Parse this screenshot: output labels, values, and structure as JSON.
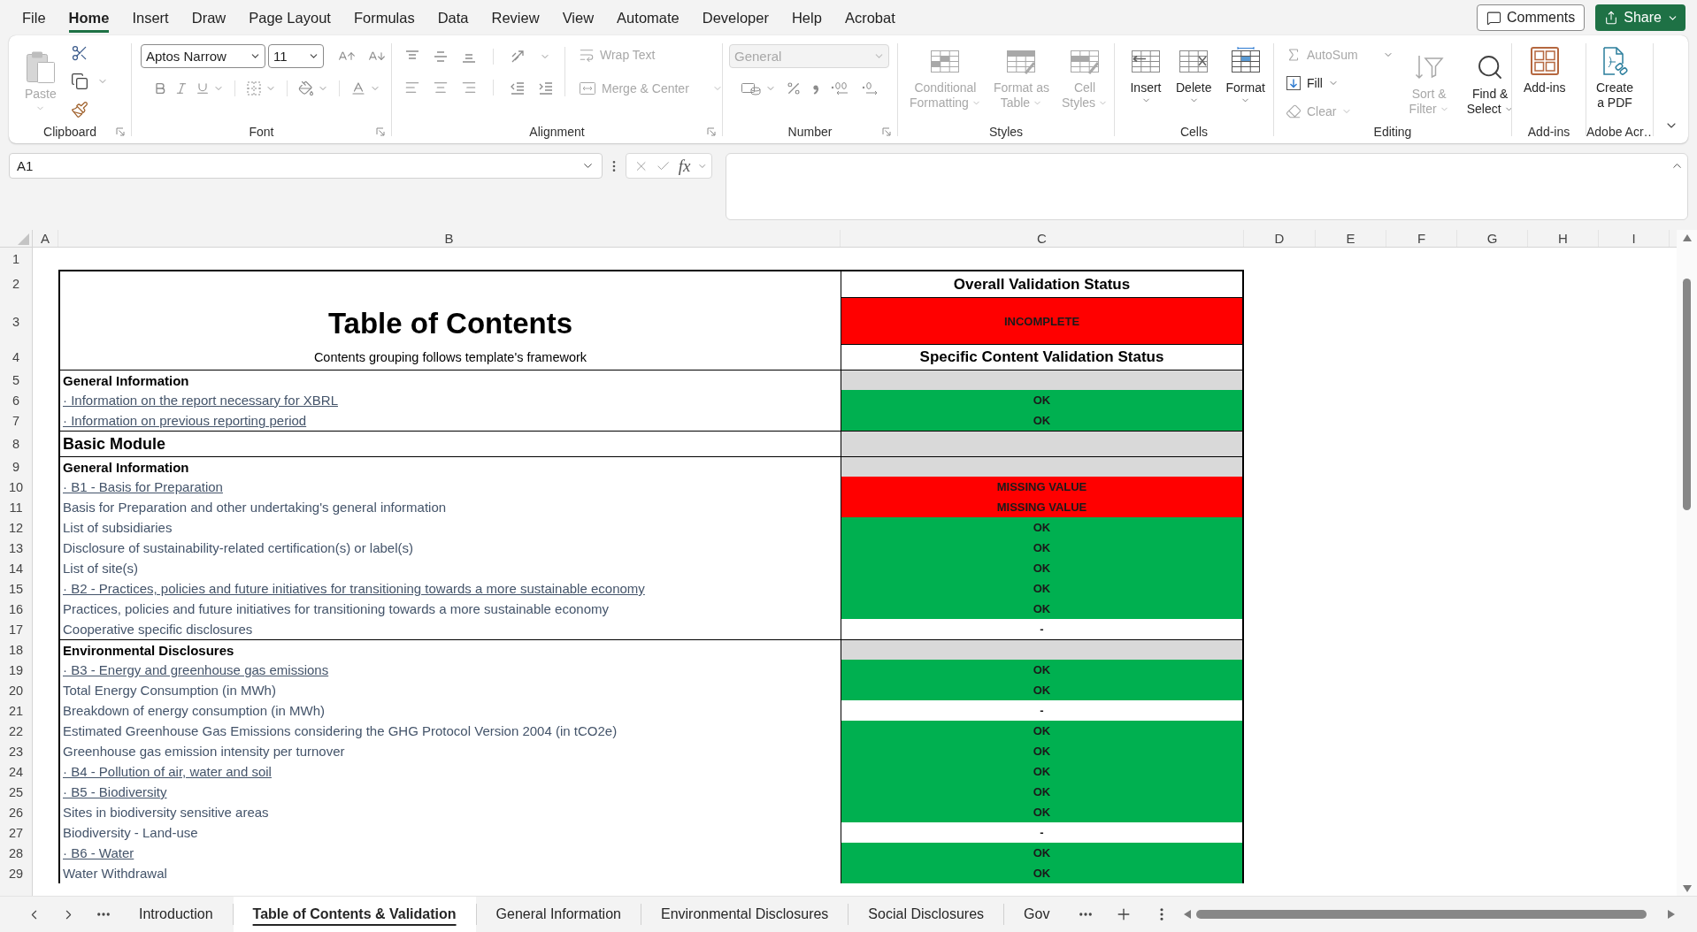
{
  "menu": {
    "tabs": [
      {
        "label": "File",
        "selected": false
      },
      {
        "label": "Home",
        "selected": true
      },
      {
        "label": "Insert",
        "selected": false
      },
      {
        "label": "Draw",
        "selected": false
      },
      {
        "label": "Page Layout",
        "selected": false
      },
      {
        "label": "Formulas",
        "selected": false
      },
      {
        "label": "Data",
        "selected": false
      },
      {
        "label": "Review",
        "selected": false
      },
      {
        "label": "View",
        "selected": false
      },
      {
        "label": "Automate",
        "selected": false
      },
      {
        "label": "Developer",
        "selected": false
      },
      {
        "label": "Help",
        "selected": false
      },
      {
        "label": "Acrobat",
        "selected": false
      }
    ],
    "comments": "Comments",
    "share": "Share"
  },
  "ribbon": {
    "groups": [
      {
        "kind": "clipboard",
        "label": "Clipboard",
        "paste": {
          "label": "Paste",
          "disabled": true
        }
      },
      {
        "kind": "font",
        "label": "Font",
        "font_name": "Aptos Narrow",
        "font_size": "11"
      },
      {
        "kind": "alignment",
        "label": "Alignment",
        "wrap": {
          "label": "Wrap Text",
          "disabled": true
        },
        "merge": {
          "label": "Merge & Center",
          "disabled": true
        }
      },
      {
        "kind": "number",
        "label": "Number",
        "format": {
          "value": "General",
          "disabled": true
        }
      },
      {
        "kind": "styles",
        "label": "Styles",
        "buttons": [
          {
            "lines": [
              "Conditional",
              "Formatting"
            ],
            "disabled": true
          },
          {
            "lines": [
              "Format as",
              "Table"
            ],
            "disabled": true
          },
          {
            "lines": [
              "Cell",
              "Styles"
            ],
            "disabled": true
          }
        ]
      },
      {
        "kind": "cells",
        "label": "Cells",
        "buttons": [
          {
            "lines": [
              "Insert"
            ],
            "disabled": false
          },
          {
            "lines": [
              "Delete"
            ],
            "disabled": false
          },
          {
            "lines": [
              "Format"
            ],
            "disabled": false
          }
        ]
      },
      {
        "kind": "editing",
        "label": "Editing",
        "small": [
          {
            "label": "AutoSum",
            "disabled": true
          },
          {
            "label": "Fill",
            "disabled": false
          },
          {
            "label": "Clear",
            "disabled": true
          }
        ],
        "buttons": [
          {
            "lines": [
              "Sort &",
              "Filter"
            ],
            "disabled": true
          },
          {
            "lines": [
              "Find &",
              "Select"
            ],
            "disabled": false
          }
        ]
      },
      {
        "kind": "addins",
        "label": "Add-ins",
        "buttons": [
          {
            "lines": [
              "Add-ins"
            ],
            "disabled": false
          }
        ]
      },
      {
        "kind": "adobe",
        "label": "Adobe Acr…",
        "buttons": [
          {
            "lines": [
              "Create",
              "a PDF"
            ],
            "disabled": false
          }
        ]
      }
    ]
  },
  "formula_bar": {
    "name_box": "A1",
    "function_symbol": "fx"
  },
  "sheet": {
    "columns": [
      "A",
      "B",
      "C",
      "D",
      "E",
      "F",
      "G",
      "H",
      "I"
    ],
    "top_rows": [
      "1",
      "2",
      "3",
      "4"
    ],
    "title": "Table of Contents",
    "subtitle": "Contents grouping follows template's framework",
    "overall_heading": "Overall Validation Status",
    "overall_status": {
      "kind": "fail",
      "text": "INCOMPLETE"
    },
    "specific_heading": "Specific Content Validation Status",
    "rows": [
      {
        "row": "5",
        "kind": "section",
        "text": "General Information",
        "status": {
          "kind": "heading"
        }
      },
      {
        "row": "6",
        "kind": "link",
        "text": "· Information on the report necessary for XBRL",
        "status": {
          "kind": "pass",
          "text": "OK"
        }
      },
      {
        "row": "7",
        "kind": "link",
        "text": "· Information on previous reporting period",
        "status": {
          "kind": "pass",
          "text": "OK"
        }
      },
      {
        "row": "8",
        "kind": "module",
        "text": "Basic Module",
        "status": {
          "kind": "heading"
        }
      },
      {
        "row": "9",
        "kind": "section",
        "text": "General Information",
        "status": {
          "kind": "heading"
        }
      },
      {
        "row": "10",
        "kind": "link",
        "text": "· B1 - Basis for Preparation",
        "status": {
          "kind": "fail",
          "text": "MISSING VALUE"
        }
      },
      {
        "row": "11",
        "kind": "item",
        "text": "Basis for Preparation and other undertaking's general information",
        "status": {
          "kind": "fail",
          "text": "MISSING VALUE"
        }
      },
      {
        "row": "12",
        "kind": "item",
        "text": "List of subsidiaries",
        "status": {
          "kind": "pass",
          "text": "OK"
        }
      },
      {
        "row": "13",
        "kind": "item",
        "text": "Disclosure of sustainability-related certification(s) or label(s)",
        "status": {
          "kind": "pass",
          "text": "OK"
        }
      },
      {
        "row": "14",
        "kind": "item",
        "text": "List of site(s)",
        "status": {
          "kind": "pass",
          "text": "OK"
        }
      },
      {
        "row": "15",
        "kind": "link",
        "text": "· B2 - Practices, policies and future initiatives for transitioning towards a more sustainable economy",
        "status": {
          "kind": "pass",
          "text": "OK"
        }
      },
      {
        "row": "16",
        "kind": "item",
        "text": "Practices, policies and future initiatives for transitioning towards a more sustainable economy",
        "status": {
          "kind": "pass",
          "text": "OK"
        }
      },
      {
        "row": "17",
        "kind": "item",
        "text": "Cooperative specific disclosures",
        "status": {
          "kind": "not_applicable",
          "text": "-"
        }
      },
      {
        "row": "18",
        "kind": "section",
        "text": "Environmental Disclosures",
        "status": {
          "kind": "heading"
        }
      },
      {
        "row": "19",
        "kind": "link",
        "text": "· B3 - Energy and greenhouse gas emissions",
        "status": {
          "kind": "pass",
          "text": "OK"
        }
      },
      {
        "row": "20",
        "kind": "item",
        "text": "Total Energy Consumption (in MWh)",
        "status": {
          "kind": "pass",
          "text": "OK"
        }
      },
      {
        "row": "21",
        "kind": "item",
        "text": "Breakdown of energy consumption (in MWh)",
        "status": {
          "kind": "not_applicable",
          "text": "-"
        }
      },
      {
        "row": "22",
        "kind": "item",
        "text": "Estimated Greenhouse Gas Emissions considering the GHG Protocol Version 2004 (in tCO2e)",
        "status": {
          "kind": "pass",
          "text": "OK"
        }
      },
      {
        "row": "23",
        "kind": "item",
        "text": "Greenhouse gas emission intensity per turnover",
        "status": {
          "kind": "pass",
          "text": "OK"
        }
      },
      {
        "row": "24",
        "kind": "link",
        "text": "· B4 - Pollution of air, water and soil",
        "status": {
          "kind": "pass",
          "text": "OK"
        }
      },
      {
        "row": "25",
        "kind": "link",
        "text": "· B5 - Biodiversity",
        "status": {
          "kind": "pass",
          "text": "OK"
        }
      },
      {
        "row": "26",
        "kind": "item",
        "text": "Sites in biodiversity sensitive areas",
        "status": {
          "kind": "pass",
          "text": "OK"
        }
      },
      {
        "row": "27",
        "kind": "item",
        "text": "Biodiversity - Land-use",
        "status": {
          "kind": "not_applicable",
          "text": "-"
        }
      },
      {
        "row": "28",
        "kind": "link",
        "text": "· B6 - Water",
        "status": {
          "kind": "pass",
          "text": "OK"
        }
      },
      {
        "row": "29",
        "kind": "item",
        "text": "Water Withdrawal",
        "status": {
          "kind": "pass",
          "text": "OK"
        }
      }
    ]
  },
  "sheet_tabs": [
    {
      "label": "Introduction",
      "selected": false
    },
    {
      "label": "Table of Contents & Validation",
      "selected": true
    },
    {
      "label": "General Information",
      "selected": false
    },
    {
      "label": "Environmental Disclosures",
      "selected": false
    },
    {
      "label": "Social Disclosures",
      "selected": false
    },
    {
      "label": "Gov",
      "selected": false
    }
  ]
}
